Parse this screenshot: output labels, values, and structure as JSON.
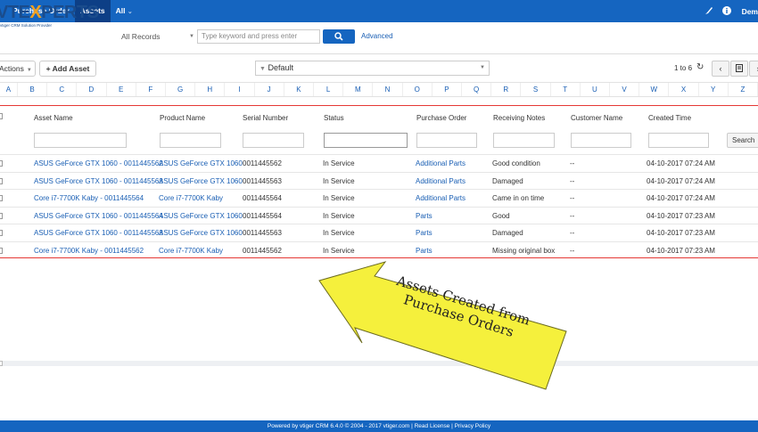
{
  "topbar": {
    "tabs": [
      "Purchase Order",
      "Assets",
      "All"
    ],
    "all_caret": "⌄",
    "user": "Dem"
  },
  "header": {
    "logo_main_a": "VTE",
    "logo_x": "X",
    "logo_main_b": "PERTS",
    "logo_sub": "vtiger CRM Solution Provider",
    "record_select": "All Records",
    "keyword_placeholder": "Type keyword and press enter",
    "advanced": "Advanced"
  },
  "toolbar": {
    "actions": "Actions",
    "add_asset": "+ Add Asset",
    "filter": "Default",
    "page_info": "1 to 6"
  },
  "alphabet": [
    "A",
    "B",
    "C",
    "D",
    "E",
    "F",
    "G",
    "H",
    "I",
    "J",
    "K",
    "L",
    "M",
    "N",
    "O",
    "P",
    "Q",
    "R",
    "S",
    "T",
    "U",
    "V",
    "W",
    "X",
    "Y",
    "Z"
  ],
  "table": {
    "columns": [
      "Asset Name",
      "Product Name",
      "Serial Number",
      "Status",
      "Purchase Order",
      "Receiving Notes",
      "Customer Name",
      "Created Time"
    ],
    "search_label": "Search",
    "rows": [
      {
        "asset": "ASUS GeForce GTX 1060 - 0011445562",
        "product": "ASUS GeForce GTX 1060",
        "serial": "0011445562",
        "status": "In Service",
        "po": "Additional Parts",
        "notes": "Good condition",
        "customer": "--",
        "created": "04-10-2017 07:24 AM"
      },
      {
        "asset": "ASUS GeForce GTX 1060 - 0011445563",
        "product": "ASUS GeForce GTX 1060",
        "serial": "0011445563",
        "status": "In Service",
        "po": "Additional Parts",
        "notes": "Damaged",
        "customer": "--",
        "created": "04-10-2017 07:24 AM"
      },
      {
        "asset": "Core i7-7700K Kaby - 0011445564",
        "product": "Core i7-7700K Kaby",
        "serial": "0011445564",
        "status": "In Service",
        "po": "Additional Parts",
        "notes": "Came in on time",
        "customer": "--",
        "created": "04-10-2017 07:24 AM"
      },
      {
        "asset": "ASUS GeForce GTX 1060 - 0011445564",
        "product": "ASUS GeForce GTX 1060",
        "serial": "0011445564",
        "status": "In Service",
        "po": "Parts",
        "notes": "Good",
        "customer": "--",
        "created": "04-10-2017 07:23 AM"
      },
      {
        "asset": "ASUS GeForce GTX 1060 - 0011445563",
        "product": "ASUS GeForce GTX 1060",
        "serial": "0011445563",
        "status": "In Service",
        "po": "Parts",
        "notes": "Damaged",
        "customer": "--",
        "created": "04-10-2017 07:23 AM"
      },
      {
        "asset": "Core i7-7700K Kaby - 0011445562",
        "product": "Core i7-7700K Kaby",
        "serial": "0011445562",
        "status": "In Service",
        "po": "Parts",
        "notes": "Missing original box",
        "customer": "--",
        "created": "04-10-2017 07:23 AM"
      }
    ]
  },
  "callout": {
    "line1": "Assets Created from",
    "line2": "Purchase Orders"
  },
  "footer": {
    "text": "Powered by vtiger CRM 6.4.0  © 2004 - 2017  vtiger.com | Read License | Privacy Policy"
  },
  "colors": {
    "brand_blue": "#1565c0",
    "link_blue": "#1a5fb4",
    "highlight_red": "#e53935",
    "callout_yellow": "#f5f03c"
  }
}
